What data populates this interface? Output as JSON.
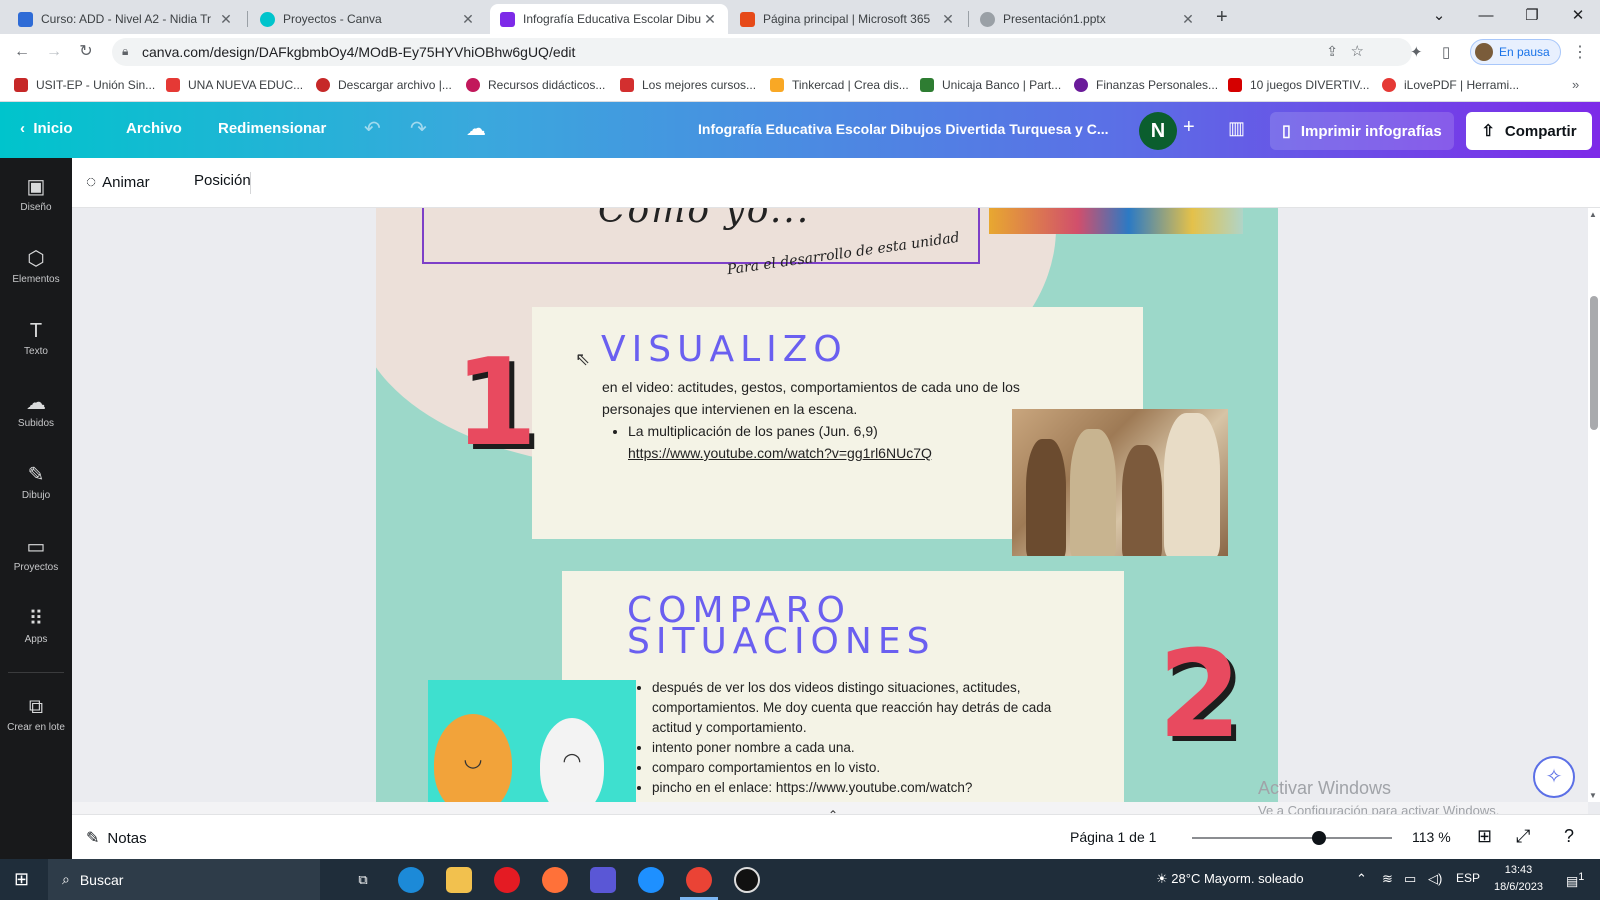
{
  "browser": {
    "tabs": [
      {
        "title": "Curso: ADD - Nivel A2 - Nidia Tr",
        "favicon_color": "#2e6bd6",
        "active": false
      },
      {
        "title": "Proyectos - Canva",
        "favicon_color": "#00c4cc",
        "active": false
      },
      {
        "title": "Infografía Educativa Escolar Dibu",
        "favicon_color": "#7d2ae8",
        "active": true
      },
      {
        "title": "Página principal | Microsoft 365",
        "favicon_color": "#e64a19",
        "active": false
      },
      {
        "title": "Presentación1.pptx",
        "favicon_color": "#9aa0a6",
        "active": false
      }
    ],
    "url": "canva.com/design/DAFkgbmbOy4/MOdB-Ey75HYVhiOBhw6gUQ/edit",
    "profile_label": "En pausa",
    "bookmarks": [
      {
        "label": "USIT-EP - Unión Sin...",
        "color": "#c62828"
      },
      {
        "label": "UNA NUEVA EDUC...",
        "color": "#e53935"
      },
      {
        "label": "Descargar archivo |...",
        "color": "#c62828"
      },
      {
        "label": "Recursos didácticos...",
        "color": "#c2185b"
      },
      {
        "label": "Los mejores cursos...",
        "color": "#d32f2f"
      },
      {
        "label": "Tinkercad | Crea dis...",
        "color": "#f9a825"
      },
      {
        "label": "Unicaja Banco | Part...",
        "color": "#2e7d32"
      },
      {
        "label": "Finanzas Personales...",
        "color": "#6a1b9a"
      },
      {
        "label": "10 juegos DIVERTIV...",
        "color": "#d50000"
      },
      {
        "label": "iLovePDF | Herrami...",
        "color": "#e53935"
      }
    ]
  },
  "canva": {
    "nav": {
      "home": "Inicio",
      "file": "Archivo",
      "resize": "Redimensionar"
    },
    "design_title": "Infografía Educativa Escolar Dibujos Divertida Turquesa y C...",
    "avatar_letter": "N",
    "print_label": "Imprimir infografías",
    "share_label": "Compartir",
    "sidebar": [
      {
        "label": "Diseño",
        "icon": "layout-icon",
        "glyph": "▣"
      },
      {
        "label": "Elementos",
        "icon": "shapes-icon",
        "glyph": "⬡"
      },
      {
        "label": "Texto",
        "icon": "text-icon",
        "glyph": "T"
      },
      {
        "label": "Subidos",
        "icon": "upload-cloud-icon",
        "glyph": "☁"
      },
      {
        "label": "Dibujo",
        "icon": "pen-icon",
        "glyph": "✎"
      },
      {
        "label": "Proyectos",
        "icon": "folder-icon",
        "glyph": "▭"
      },
      {
        "label": "Apps",
        "icon": "apps-grid-icon",
        "glyph": "⠿"
      },
      {
        "label": "Crear en lote",
        "icon": "bulk-create-icon",
        "glyph": "⧉"
      }
    ],
    "context_toolbar": {
      "animate": "Animar",
      "position": "Posición"
    },
    "footer": {
      "notes": "Notas",
      "page_info": "Página 1 de 1",
      "zoom": "113 %",
      "zoom_fraction": 0.6
    }
  },
  "infographic": {
    "top_title_partial": "Como yo...",
    "subcaption": "Para el desarrollo de esta unidad",
    "section1": {
      "number": "1",
      "heading": "VISUALIZO",
      "body": "en el video: actitudes, gestos, comportamientos de cada uno de los personajes que intervienen en la escena.",
      "bullet": "La multiplicación de los panes   (Jun. 6,9)",
      "link": "https://www.youtube.com/watch?v=gg1rl6NUc7Q"
    },
    "section2": {
      "number": "2",
      "heading": "COMPARO SITUACIONES",
      "bullets": [
        "después de ver los dos videos distingo situaciones, actitudes, comportamientos. Me doy cuenta que reacción hay detrás de cada actitud y comportamiento.",
        "intento poner nombre a cada una.",
        "comparo comportamientos en lo visto.",
        "pincho en el enlace: https://www.youtube.com/watch?"
      ]
    }
  },
  "windows": {
    "activation_title": "Activar Windows",
    "activation_sub": "Ve a Configuración para activar Windows.",
    "search_placeholder": "Buscar",
    "weather": "28°C  Mayorm. soleado",
    "lang": "ESP",
    "time": "13:43",
    "date": "18/6/2023",
    "notification_count": "1"
  },
  "colors": {
    "canva_gradient_start": "#00c4cc",
    "canva_gradient_end": "#7d2ae8",
    "heading_color": "#6a5ff0",
    "number_color": "#e84a5f",
    "page_bg": "#9cd8c9"
  }
}
